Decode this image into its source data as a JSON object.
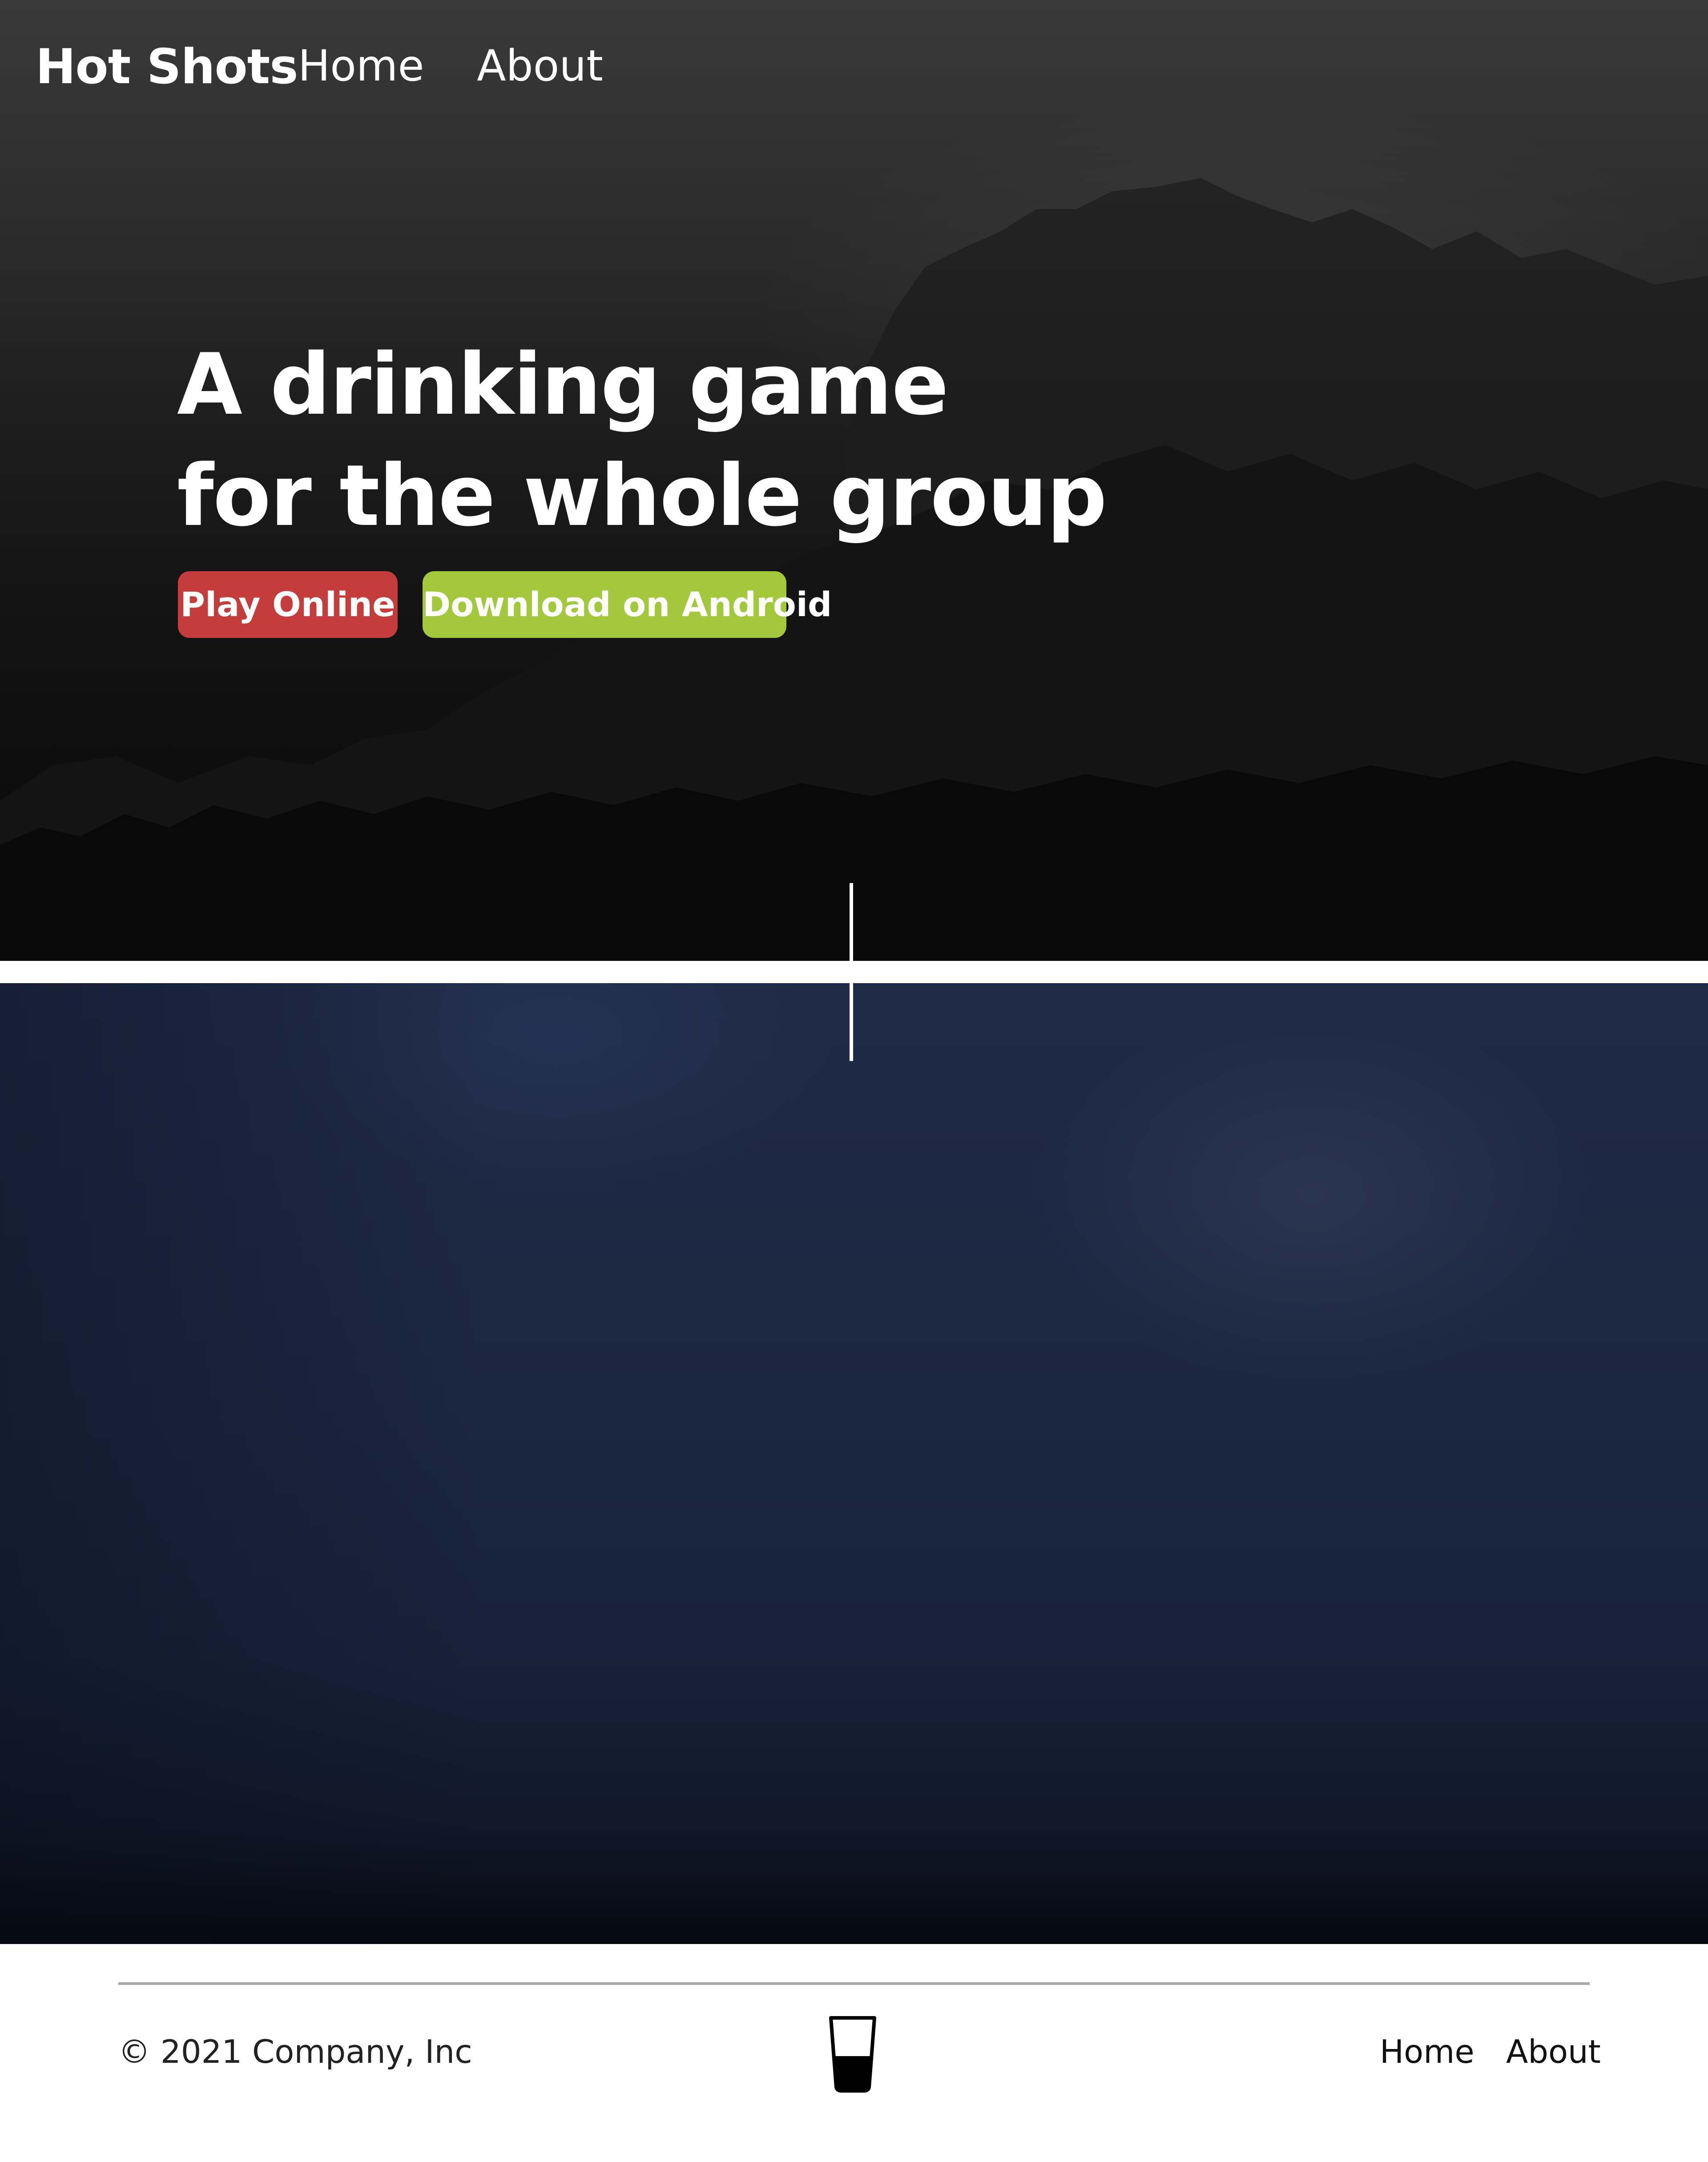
{
  "navbar": {
    "brand": "Hot Shots",
    "links": [
      "Home",
      "About"
    ]
  },
  "hero": {
    "headline_line1": "A drinking game",
    "headline_line2": "for the whole group",
    "buttons": {
      "play_online": "Play Online",
      "download_android": "Download on Android"
    }
  },
  "footer": {
    "copyright": "© 2021 Company, Inc",
    "logo_icon": "shot-glass-icon",
    "links": [
      "Home",
      "About"
    ]
  },
  "colors": {
    "play_online": "#c43c3c",
    "download_android": "#a3c83c",
    "hero_overlay": "#262626",
    "section_blue": "#1b2640"
  }
}
